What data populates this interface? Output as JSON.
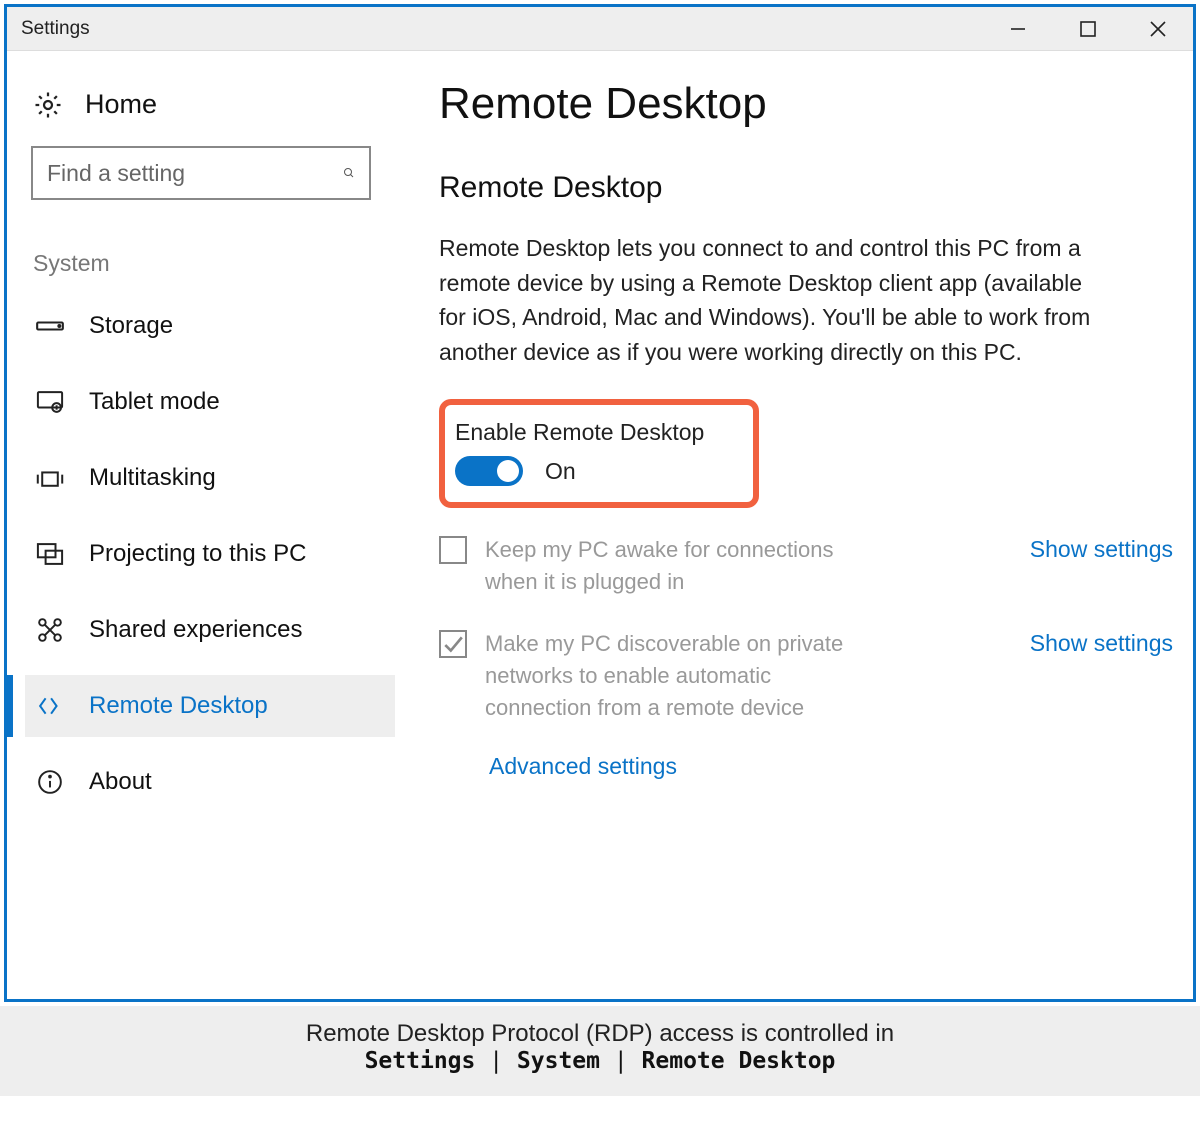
{
  "window": {
    "title": "Settings"
  },
  "sidebar": {
    "home": "Home",
    "search_placeholder": "Find a setting",
    "section": "System",
    "items": [
      {
        "label": "Storage"
      },
      {
        "label": "Tablet mode"
      },
      {
        "label": "Multitasking"
      },
      {
        "label": "Projecting to this PC"
      },
      {
        "label": "Shared experiences"
      },
      {
        "label": "Remote Desktop"
      },
      {
        "label": "About"
      }
    ]
  },
  "main": {
    "title": "Remote Desktop",
    "subtitle": "Remote Desktop",
    "description": "Remote Desktop lets you connect to and control this PC from a remote device by using a Remote Desktop client app (available for iOS, Android, Mac and Windows). You'll be able to work from another device as if you were working directly on this PC.",
    "toggle_label": "Enable Remote Desktop",
    "toggle_state": "On",
    "option1": "Keep my PC awake for connections when it is plugged in",
    "option1_link": "Show settings",
    "option2": "Make my PC discoverable on private networks to enable automatic connection from a remote device",
    "option2_link": "Show settings",
    "advanced": "Advanced settings"
  },
  "caption": {
    "line1": "Remote Desktop Protocol (RDP) access is controlled in",
    "crumb1": "Settings",
    "crumb2": "System",
    "crumb3": "Remote Desktop",
    "sep": " | "
  }
}
